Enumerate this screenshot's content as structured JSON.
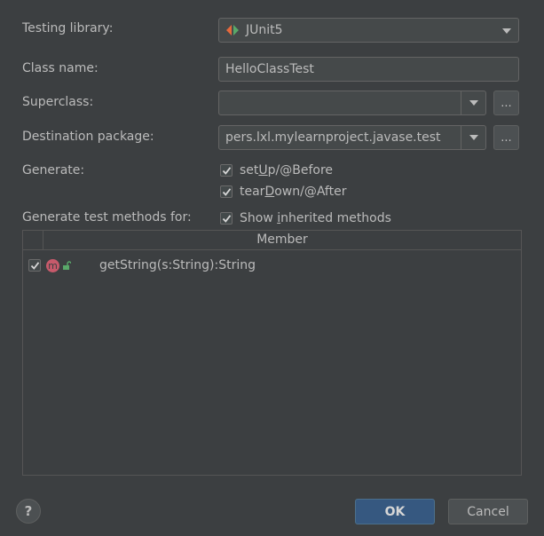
{
  "form": {
    "testing_library_label": "Testing library:",
    "testing_library_value": "JUnit5",
    "class_name_label": "Class name:",
    "class_name_value": "HelloClassTest",
    "superclass_label": "Superclass:",
    "superclass_value": "",
    "destination_label": "Destination package:",
    "destination_value": "pers.lxl.mylearnproject.javase.test",
    "browse_label": "...",
    "generate_label": "Generate:",
    "setup_pre": "set",
    "setup_u": "U",
    "setup_post": "p/@Before",
    "teardown_pre": "tear",
    "teardown_u": "D",
    "teardown_post": "own/@After",
    "methods_label": "Generate test methods for:",
    "inherited_pre": "Show ",
    "inherited_u": "i",
    "inherited_post": "nherited methods"
  },
  "table": {
    "column_header": "Member",
    "rows": [
      {
        "checked": true,
        "badge": "m",
        "signature": "getString(s:String):String"
      }
    ]
  },
  "footer": {
    "help": "?",
    "ok": "OK",
    "cancel": "Cancel"
  },
  "colors": {
    "background": "#3c3f41",
    "ok_button": "#365880",
    "method_badge": "#c75a6b",
    "unlock_icon": "#59a869"
  }
}
